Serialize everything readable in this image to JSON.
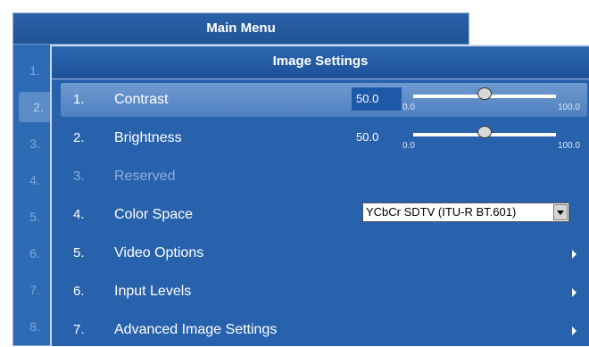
{
  "main_menu": {
    "title": "Main Menu",
    "items": [
      "1.",
      "2.",
      "3.",
      "4.",
      "5.",
      "6.",
      "7.",
      "8."
    ]
  },
  "image_settings": {
    "title": "Image Settings",
    "items": [
      {
        "num": "1.",
        "label": "Contrast",
        "value": "50.0",
        "min": "0.0",
        "max": "100.0",
        "level": 0.5
      },
      {
        "num": "2.",
        "label": "Brightness",
        "value": "50.0",
        "min": "0.0",
        "max": "100.0",
        "level": 0.5
      },
      {
        "num": "3.",
        "label": "Reserved"
      },
      {
        "num": "4.",
        "label": "Color Space",
        "select_value": "YCbCr SDTV (ITU-R BT.601)"
      },
      {
        "num": "5.",
        "label": "Video Options"
      },
      {
        "num": "6.",
        "label": "Input Levels"
      },
      {
        "num": "7.",
        "label": "Advanced Image Settings"
      }
    ]
  },
  "colors": {
    "menu_blue": "#2862ad",
    "selected_row": "#5b8cc8",
    "disabled_text": "#8ab0de"
  }
}
